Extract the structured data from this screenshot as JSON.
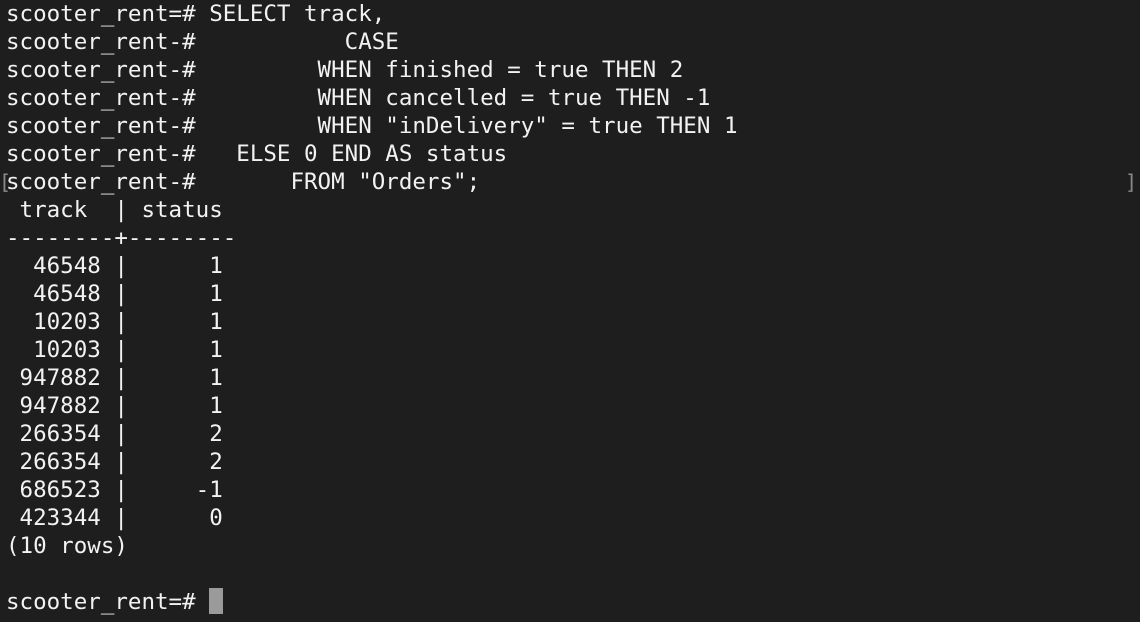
{
  "terminal": {
    "query_lines": [
      "scooter_rent=# SELECT track,",
      "scooter_rent-#           CASE",
      "scooter_rent-#         WHEN finished = true THEN 2",
      "scooter_rent-#         WHEN cancelled = true THEN -1",
      "scooter_rent-#         WHEN \"inDelivery\" = true THEN 1",
      "scooter_rent-#   ELSE 0 END AS status",
      "scooter_rent-#       FROM \"Orders\";"
    ],
    "result": {
      "columns": [
        "track",
        "status"
      ],
      "header_line": " track  | status",
      "separator_line": "--------+--------",
      "rows": [
        "  46548 |      1",
        "  46548 |      1",
        "  10203 |      1",
        "  10203 |      1",
        " 947882 |      1",
        " 947882 |      1",
        " 266354 |      2",
        " 266354 |      2",
        " 686523 |     -1",
        " 423344 |      0"
      ],
      "row_count": "(10 rows)"
    },
    "prompt": "scooter_rent=# ",
    "bracket_left": "[",
    "bracket_right": "]"
  }
}
